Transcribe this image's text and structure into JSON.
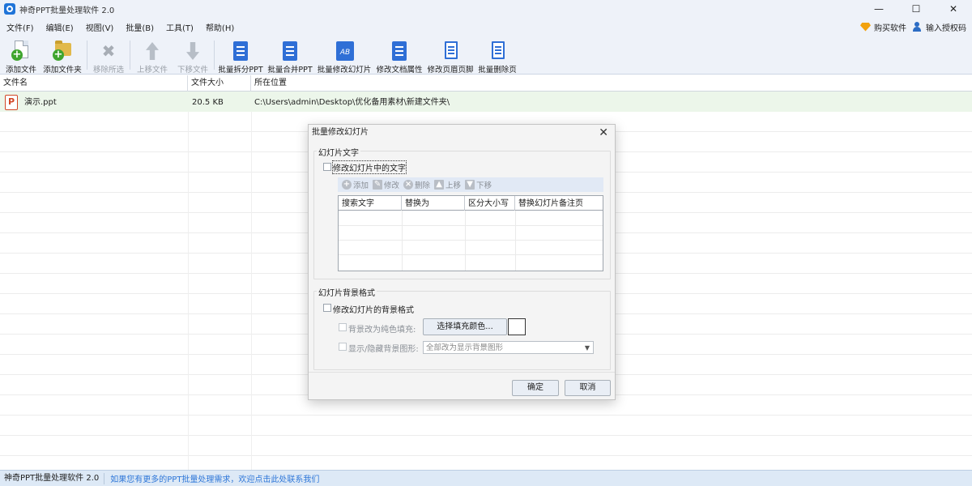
{
  "window": {
    "title": "神奇PPT批量处理软件 2.0",
    "minimize": "—",
    "maximize": "☐",
    "close": "✕"
  },
  "menu": {
    "items": [
      "文件(F)",
      "编辑(E)",
      "视图(V)",
      "批量(B)",
      "工具(T)",
      "帮助(H)"
    ],
    "buy": "购买软件",
    "license": "输入授权码"
  },
  "toolbar": {
    "add_file": "添加文件",
    "add_folder": "添加文件夹",
    "remove": "移除所选",
    "move_up": "上移文件",
    "move_down": "下移文件",
    "split": "批量拆分PPT",
    "merge": "批量合并PPT",
    "modify_slides": "批量修改幻灯片",
    "doc_props": "修改文档属性",
    "header_footer": "修改页眉页脚",
    "delete_pages": "批量删除页",
    "ab_text": "AB"
  },
  "file_list": {
    "columns": [
      "文件名",
      "文件大小",
      "所在位置"
    ],
    "rows": [
      {
        "icon": "P",
        "name": "演示.ppt",
        "size": "20.5 KB",
        "path": "C:\\Users\\admin\\Desktop\\优化备用素材\\新建文件夹\\"
      }
    ]
  },
  "status": {
    "app": "神奇PPT批量处理软件 2.0",
    "link": "如果您有更多的PPT批量处理需求，欢迎点击此处联系我们"
  },
  "dialog": {
    "title": "批量修改幻灯片",
    "close": "✕",
    "text_group": "幻灯片文字",
    "modify_text": "修改幻灯片中的文字",
    "modify_text_checked": false,
    "tools": {
      "add": "添加",
      "edit": "修改",
      "delete": "删除",
      "up": "上移",
      "down": "下移"
    },
    "table_columns": [
      "搜索文字",
      "替换为",
      "区分大小写",
      "替换幻灯片备注页"
    ],
    "bg_group": "幻灯片背景格式",
    "modify_bg": "修改幻灯片的背景格式",
    "solid_fill": "背景改为纯色填充:",
    "choose_color": "选择填充颜色...",
    "fill_color": "#ffffff",
    "show_hide": "显示/隐藏背景图形:",
    "show_hide_value": "全部改为显示背景图形",
    "ok": "确定",
    "cancel": "取消"
  }
}
